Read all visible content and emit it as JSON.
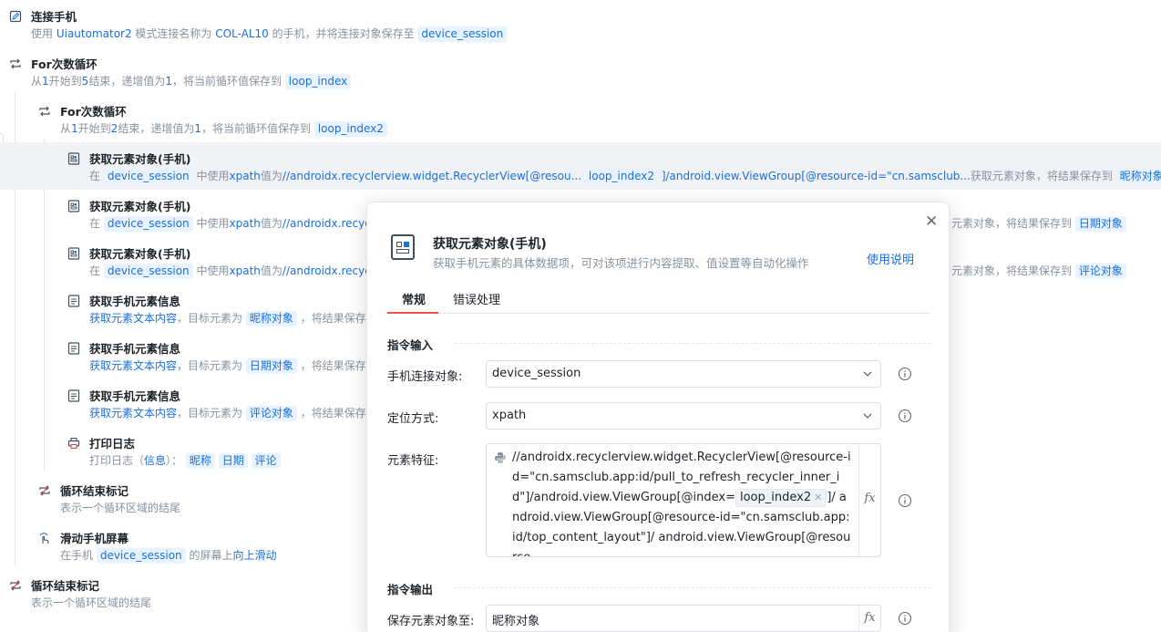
{
  "steps": [
    {
      "title": "连接手机",
      "desc": [
        "使用 ",
        {
          "t": "Uiautomator2",
          "c": "hl"
        },
        " 模式连接名称为 ",
        {
          "t": "COL-AL10",
          "c": "hl"
        },
        " 的手机，并将连接对象保存至 ",
        {
          "t": "device_session",
          "c": "tag"
        }
      ]
    },
    {
      "title": "For次数循环",
      "desc": [
        "从",
        {
          "t": "1",
          "c": "hl"
        },
        "开始到",
        {
          "t": "5",
          "c": "hl"
        },
        "结束，递增值为",
        {
          "t": "1",
          "c": "hl"
        },
        "，将当前循环值保存到 ",
        {
          "t": "loop_index",
          "c": "tag"
        }
      ]
    },
    {
      "title": "For次数循环",
      "desc": [
        "从",
        {
          "t": "1",
          "c": "hl"
        },
        "开始到",
        {
          "t": "2",
          "c": "hl"
        },
        "结束，递增值为",
        {
          "t": "1",
          "c": "hl"
        },
        "，将当前循环值保存到 ",
        {
          "t": "loop_index2",
          "c": "tag"
        }
      ]
    },
    {
      "title": "获取元素对象(手机)",
      "desc": [
        "在 ",
        {
          "t": "device_session",
          "c": "tag"
        },
        " 中使用",
        {
          "t": "xpath",
          "c": "hl"
        },
        "值为",
        {
          "t": "//androidx.recyclerview.widget.RecyclerView[@resou...",
          "c": "hl"
        },
        " ",
        {
          "t": "loop_index2",
          "c": "tag"
        },
        " ",
        {
          "t": "]/android.view.ViewGroup[@resource-id=\"cn.samsclub...",
          "c": "hl"
        },
        "获取元素对象，将结果保存到 ",
        {
          "t": "昵称对象",
          "c": "tag"
        }
      ]
    },
    {
      "title": "获取元素对象(手机)",
      "desc": [
        "在 ",
        {
          "t": "device_session",
          "c": "tag"
        },
        " 中使用",
        {
          "t": "xpath",
          "c": "hl"
        },
        "值为",
        {
          "t": "//androidx.recycle",
          "c": "hl"
        }
      ],
      "tail": [
        "元素对象，将结果保存到 ",
        {
          "t": "日期对象",
          "c": "tag"
        }
      ]
    },
    {
      "title": "获取元素对象(手机)",
      "desc": [
        "在 ",
        {
          "t": "device_session",
          "c": "tag"
        },
        " 中使用",
        {
          "t": "xpath",
          "c": "hl"
        },
        "值为",
        {
          "t": "//androidx.recycle",
          "c": "hl"
        }
      ],
      "tail": [
        "元素对象，将结果保存到 ",
        {
          "t": "评论对象",
          "c": "tag"
        }
      ]
    },
    {
      "title": "获取手机元素信息",
      "desc": [
        {
          "t": "获取元素文本内容",
          "c": "hl"
        },
        "，目标元素为 ",
        {
          "t": "昵称对象",
          "c": "tag"
        },
        " ，将结果保存至"
      ]
    },
    {
      "title": "获取手机元素信息",
      "desc": [
        {
          "t": "获取元素文本内容",
          "c": "hl"
        },
        "，目标元素为 ",
        {
          "t": "日期对象",
          "c": "tag"
        },
        " ，将结果保存至"
      ]
    },
    {
      "title": "获取手机元素信息",
      "desc": [
        {
          "t": "获取元素文本内容",
          "c": "hl"
        },
        "，目标元素为 ",
        {
          "t": "评论对象",
          "c": "tag"
        },
        " ，将结果保存至"
      ]
    },
    {
      "title": "打印日志",
      "desc": [
        "打印日志（",
        {
          "t": "信息",
          "c": "hl"
        },
        "）： ",
        {
          "t": "昵称",
          "c": "tag"
        },
        " ",
        {
          "t": "日期",
          "c": "tag"
        },
        " ",
        {
          "t": "评论",
          "c": "tag"
        }
      ]
    },
    {
      "title": "循环结束标记",
      "desc": [
        "表示一个循环区域的结尾"
      ]
    },
    {
      "title": "滑动手机屏幕",
      "desc": [
        "在手机 ",
        {
          "t": "device_session",
          "c": "tag"
        },
        " 的屏幕上",
        {
          "t": "向上滑动",
          "c": "hl"
        }
      ]
    },
    {
      "title": "循环结束标记",
      "desc": [
        "表示一个循环区域的结尾"
      ]
    }
  ],
  "dialog": {
    "title": "获取元素对象(手机)",
    "subtitle": "获取手机元素的具体数据项，可对该项进行内容提取、值设置等自动化操作",
    "help_link": "使用说明",
    "tabs": [
      "常规",
      "错误处理"
    ],
    "input_section": "指令输入",
    "output_section": "指令输出",
    "device_label": "手机连接对象:",
    "device_value": "device_session",
    "locate_label": "定位方式:",
    "locate_value": "xpath",
    "feature_label": "元素特征:",
    "feature_pre": "//androidx.recyclerview.widget.RecyclerView[@resource-id=\"cn.samsclub.app:id/pull_to_refresh_recycler_inner_id\"]/android.view.ViewGroup[@index=",
    "feature_var": "loop_index2",
    "feature_post": "]/ android.view.ViewGroup[@resource-id=\"cn.samsclub.app:id/top_content_layout\"]/ android.view.ViewGroup[@resource-",
    "fx": "fx",
    "save_label": "保存元素对象至:",
    "save_value": "昵称对象"
  }
}
